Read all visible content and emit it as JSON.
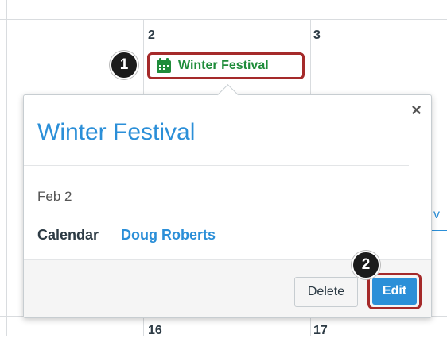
{
  "calendar": {
    "day_numbers": {
      "d2": "2",
      "d3": "3",
      "d16": "16",
      "d17": "17"
    },
    "event_chip": {
      "label": "Winter Festival",
      "color": "#1f8c3a"
    },
    "peek_letter": "v"
  },
  "callouts": {
    "one": "1",
    "two": "2"
  },
  "popover": {
    "close": "×",
    "title": "Winter Festival",
    "date": "Feb 2",
    "calendar_label": "Calendar",
    "calendar_value": "Doug Roberts",
    "delete_label": "Delete",
    "edit_label": "Edit"
  },
  "colors": {
    "accent": "#2b8fd8",
    "highlight": "#a52a2a",
    "event": "#1f8c3a"
  }
}
